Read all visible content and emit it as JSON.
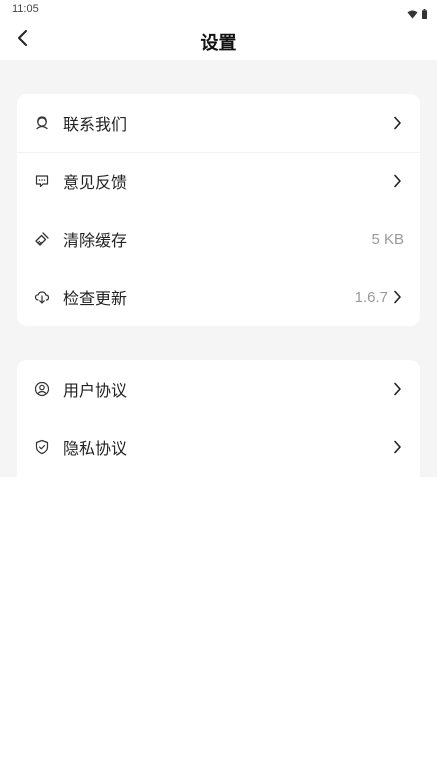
{
  "status_bar": {
    "time": "11:05"
  },
  "header": {
    "title": "设置"
  },
  "group1": [
    {
      "label": "联系我们",
      "value": "",
      "icon": "headset-icon"
    },
    {
      "label": "意见反馈",
      "value": "",
      "icon": "feedback-chat-icon"
    },
    {
      "label": "清除缓存",
      "value": "5 KB",
      "icon": "broom-icon"
    },
    {
      "label": "检查更新",
      "value": "1.6.7",
      "icon": "cloud-download-icon"
    }
  ],
  "group2": [
    {
      "label": "用户协议",
      "value": "",
      "icon": "user-circle-icon"
    },
    {
      "label": "隐私协议",
      "value": "",
      "icon": "shield-check-icon"
    }
  ],
  "colors": {
    "background": "#f5f5f5",
    "card": "#ffffff",
    "text": "#222222",
    "secondary_text": "#9a9a9a"
  }
}
